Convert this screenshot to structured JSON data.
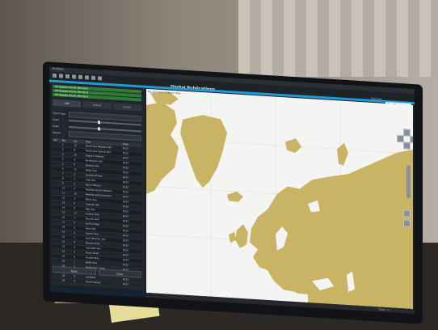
{
  "app": {
    "window_title": "Endlose",
    "title": "Digital Publications",
    "top_right_link": "Settings",
    "palette_select": "Day Black",
    "map_tab_label": "My Sea Area / Custom Map"
  },
  "chart_list": {
    "items": [
      "UK Update Charts NM 2023",
      "UK Update Charts NM 2023",
      "UK Update Charts NM 2023"
    ]
  },
  "tabs": [
    {
      "label": "List",
      "active": true
    },
    {
      "label": "Details",
      "active": false
    },
    {
      "label": "Export",
      "active": false
    }
  ],
  "filters": {
    "rows": [
      {
        "label": "Chart type",
        "kind": "box"
      },
      {
        "label": "Scale",
        "kind": "slider"
      },
      {
        "label": "Scale",
        "kind": "slider"
      },
      {
        "label": "Search",
        "kind": "box"
      }
    ]
  },
  "table": {
    "headers": [
      "Sel",
      "No.",
      "Ed.",
      "Title",
      "Date"
    ],
    "rows": [
      [
        "",
        "1",
        "12",
        "North Sea Western Part",
        "2023"
      ],
      [
        "",
        "2",
        "8",
        "North Sea Central Part",
        "2023"
      ],
      [
        "",
        "3",
        "14",
        "English Channel",
        "2023"
      ],
      [
        "",
        "4",
        "6",
        "Norwegian Sea",
        "2023"
      ],
      [
        "",
        "5",
        "9",
        "Barents Sea",
        "2023"
      ],
      [
        "",
        "6",
        "11",
        "Baltic Sea",
        "2023"
      ],
      [
        "",
        "7",
        "5",
        "Greenland Sea",
        "2023"
      ],
      [
        "",
        "8",
        "7",
        "Irish Sea",
        "2023"
      ],
      [
        "",
        "9",
        "3",
        "Bay of Biscay",
        "2023"
      ],
      [
        "",
        "10",
        "4",
        "Mediterranean Western",
        "2023"
      ],
      [
        "",
        "11",
        "10",
        "Mediterranean Eastern",
        "2023"
      ],
      [
        "",
        "12",
        "2",
        "Black Sea",
        "2023"
      ],
      [
        "",
        "13",
        "6",
        "Caspian Sea",
        "2023"
      ],
      [
        "",
        "14",
        "8",
        "Red Sea",
        "2023"
      ],
      [
        "",
        "15",
        "12",
        "Arabian Sea",
        "2023"
      ],
      [
        "",
        "16",
        "1",
        "Persian Gulf",
        "2023"
      ],
      [
        "",
        "17",
        "9",
        "Gulf of Aden",
        "2023"
      ],
      [
        "",
        "18",
        "3",
        "Kara Sea",
        "2023"
      ],
      [
        "",
        "19",
        "5",
        "Laptev Sea",
        "2023"
      ],
      [
        "",
        "20",
        "7",
        "East Siberian Sea",
        "2023"
      ],
      [
        "",
        "21",
        "4",
        "Bering Strait",
        "2023"
      ],
      [
        "",
        "22",
        "6",
        "Labrador Sea",
        "2023"
      ],
      [
        "",
        "23",
        "2",
        "Davis Strait",
        "2023"
      ],
      [
        "",
        "24",
        "8",
        "Hudson Bay",
        "2023"
      ],
      [
        "",
        "25",
        "1",
        "Baffin Bay",
        "2023"
      ],
      [
        "",
        "26",
        "5",
        "Norwegian Coast",
        "2023"
      ],
      [
        "",
        "27",
        "3",
        "Iceland",
        "2023"
      ],
      [
        "",
        "28",
        "9",
        "Svalbard",
        "2023"
      ],
      [
        "",
        "29",
        "4",
        "Faroe Islands",
        "2023"
      ]
    ]
  },
  "buttons": {
    "apply": "Apply",
    "close": "Close"
  },
  "status": {
    "text": "Zoom 1:1"
  },
  "colors": {
    "accent": "#1f9ad6",
    "land": "#c9b466",
    "sea": "#f4f4f2",
    "chart_list_green": "#2f7d34"
  }
}
